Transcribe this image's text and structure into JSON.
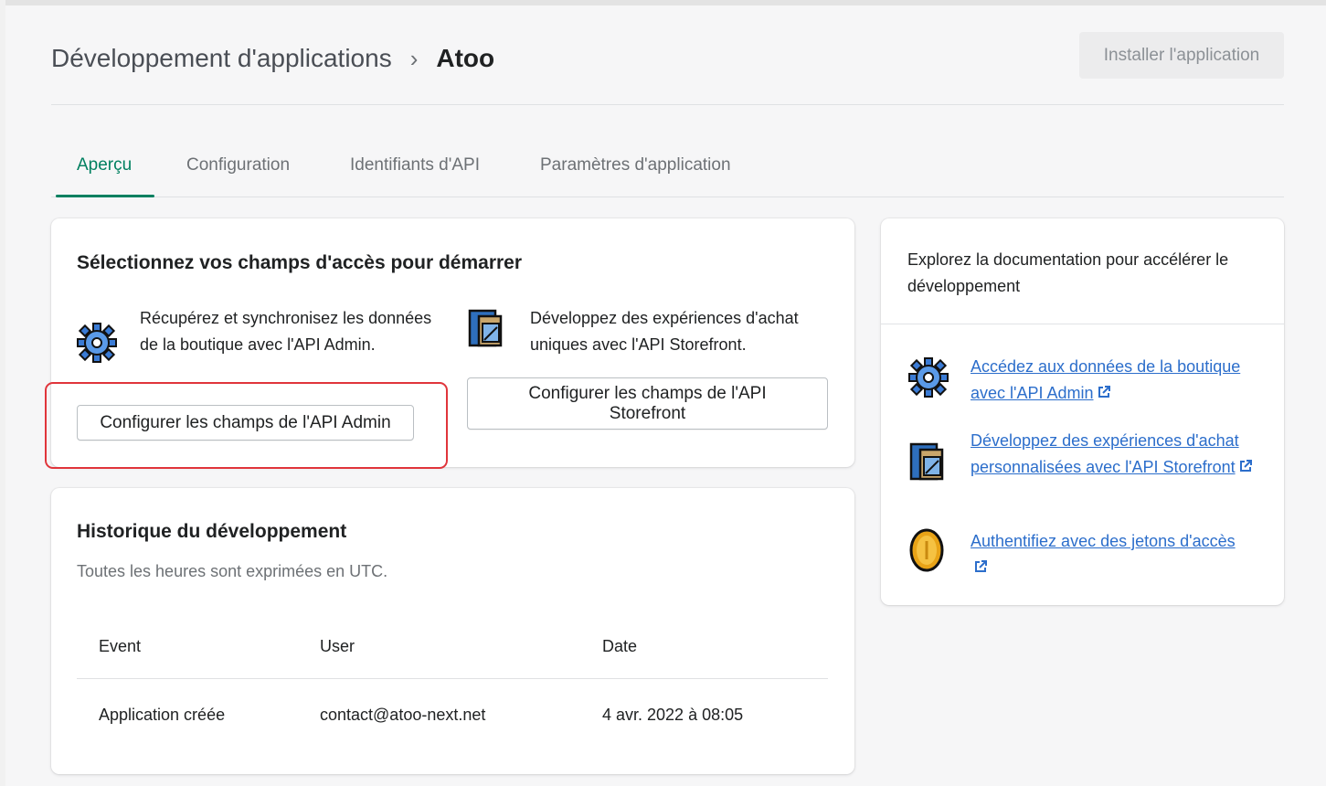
{
  "header": {
    "breadcrumb_parent": "Développement d'applications",
    "breadcrumb_separator": "›",
    "breadcrumb_current": "Atoo",
    "install_button": "Installer l'application"
  },
  "tabs": [
    {
      "label": "Aperçu",
      "active": true
    },
    {
      "label": "Configuration",
      "active": false
    },
    {
      "label": "Identifiants d'API",
      "active": false
    },
    {
      "label": "Paramètres d'application",
      "active": false
    }
  ],
  "access_card": {
    "title": "Sélectionnez vos champs d'accès pour démarrer",
    "admin": {
      "icon": "gear-icon",
      "text": "Récupérez et synchronisez les données de la boutique avec l'API Admin.",
      "button": "Configurer les champs de l'API Admin"
    },
    "storefront": {
      "icon": "storefront-icon",
      "text": "Développez des expériences d'achat uniques avec l'API Storefront.",
      "button": "Configurer les champs de l'API Storefront"
    }
  },
  "history_card": {
    "title": "Historique du développement",
    "subtitle": "Toutes les heures sont exprimées en UTC.",
    "columns": [
      "Event",
      "User",
      "Date"
    ],
    "rows": [
      {
        "event": "Application créée",
        "user": "contact@atoo-next.net",
        "date": "4 avr. 2022 à 08:05"
      }
    ]
  },
  "docs_card": {
    "intro": "Explorez la documentation pour accélérer le développement",
    "links": [
      {
        "icon": "gear-icon",
        "text": "Accédez aux données de la boutique avec l'API Admin"
      },
      {
        "icon": "storefront-icon",
        "text": "Développez des expériences d'achat personnalisées avec l'API Storefront"
      },
      {
        "icon": "coin-icon",
        "text": "Authentifiez avec des jetons d'accès"
      }
    ],
    "external_icon": "external-link-icon"
  },
  "colors": {
    "accent": "#008060",
    "link": "#2c6ecb",
    "highlight": "#e0353b"
  }
}
